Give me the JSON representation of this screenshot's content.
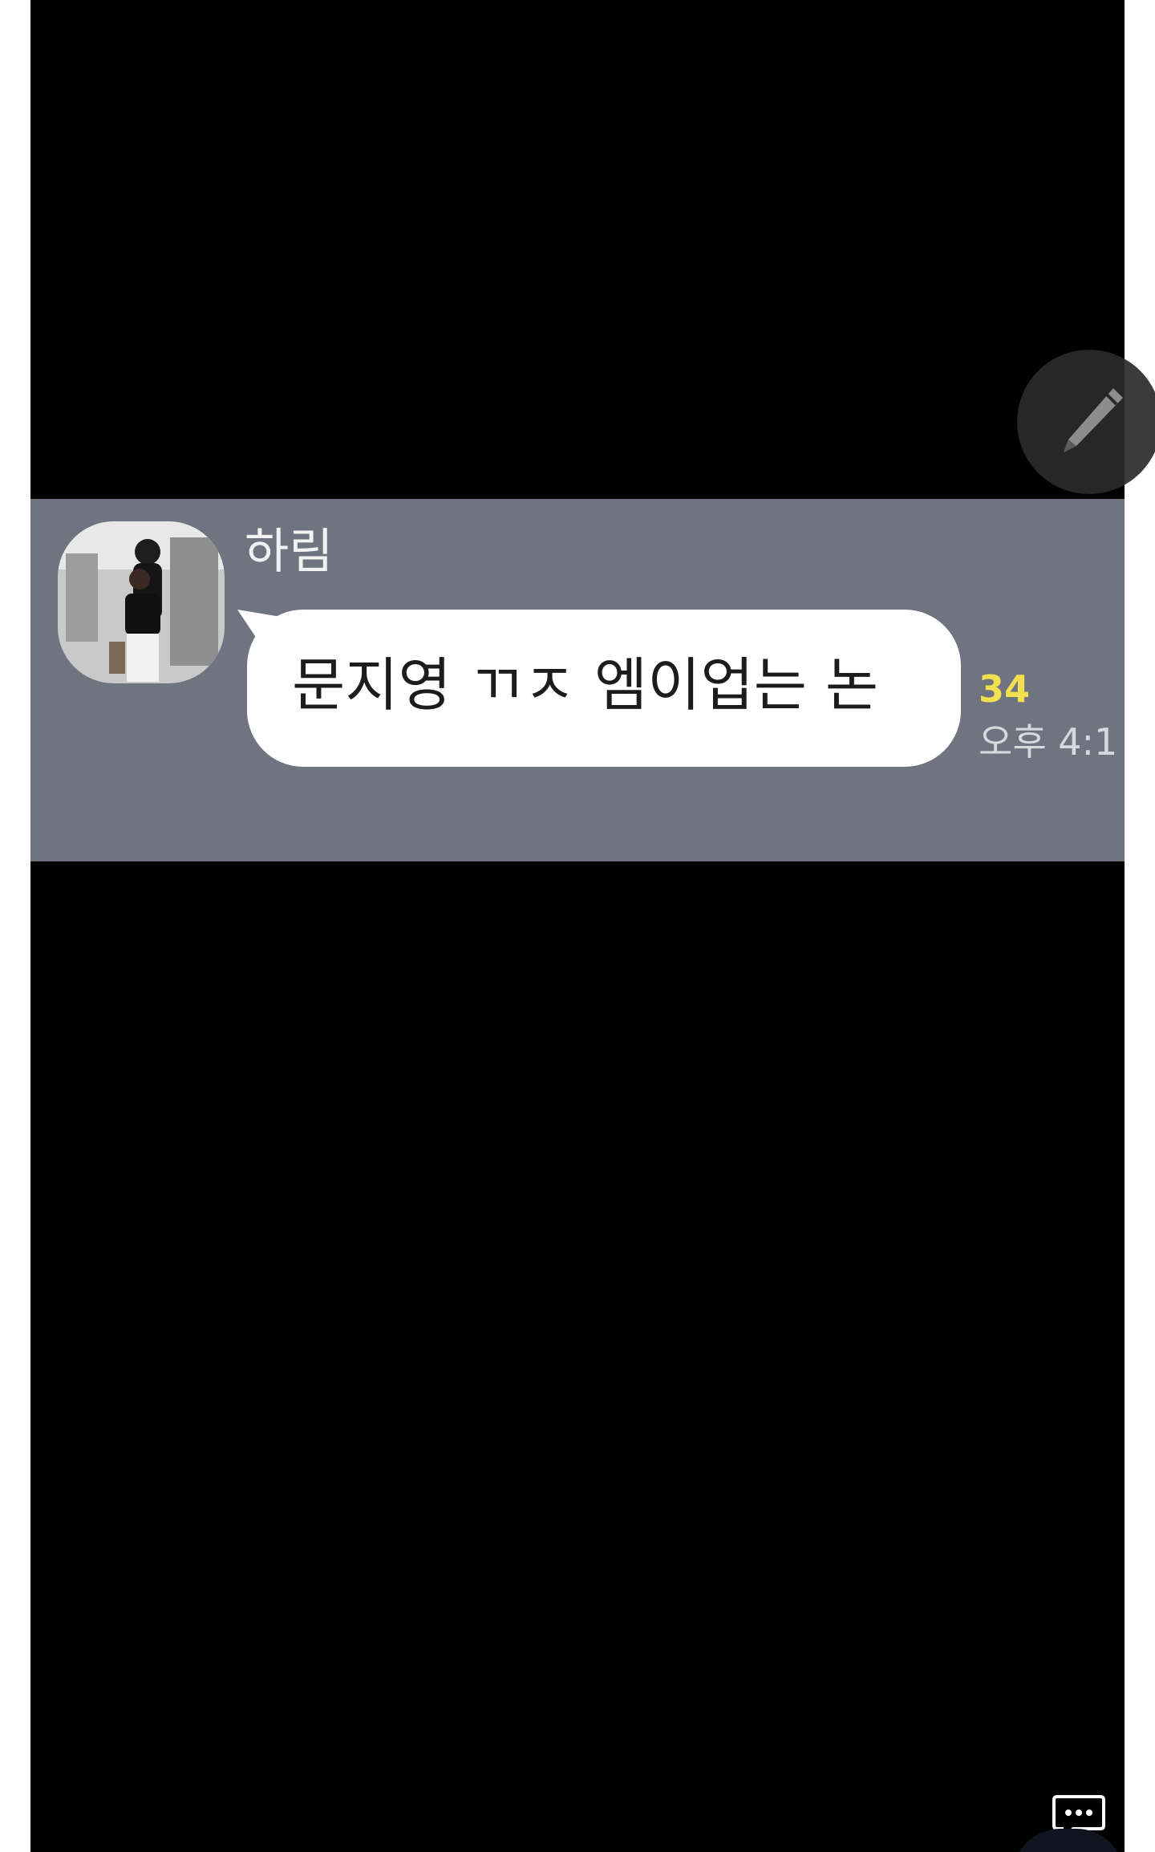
{
  "chat": {
    "sender_name": "하림",
    "message": "문지영 ㄲㅈ 엠이업는 논",
    "unread_count": "34",
    "timestamp": "오후 4:1"
  },
  "icons": {
    "edit": "pencil-icon",
    "comments": "comment-bubble-icon",
    "avatar": "profile-photo"
  },
  "colors": {
    "chat_background": "#6f7480",
    "bubble": "#ffffff",
    "unread": "#f2df52",
    "frame": "#000000"
  }
}
